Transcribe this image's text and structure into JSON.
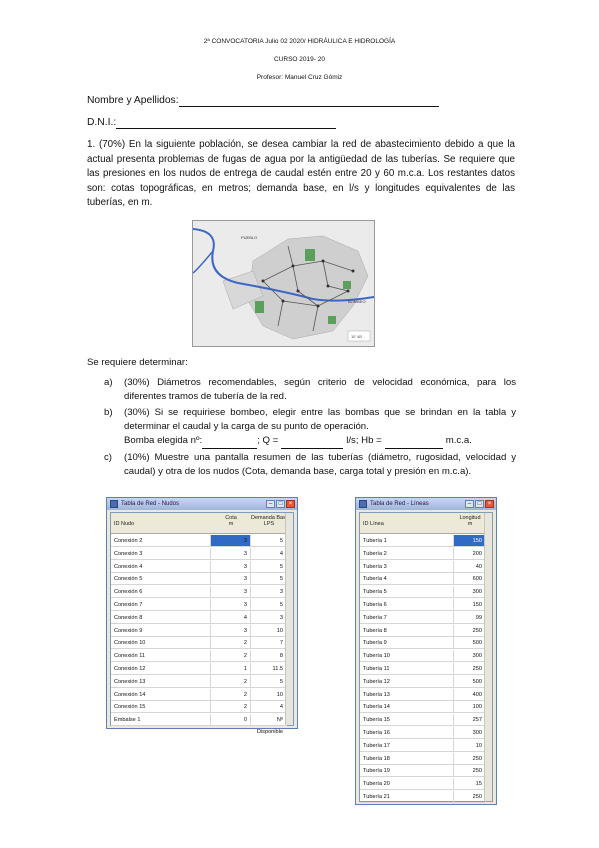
{
  "header": {
    "convocatoria": "2ª CONVOCATORIA Julio 02 2020/ HIDRÁULICA E HIDROLOGÍA",
    "curso": "CURSO 2019- 20",
    "profesor": "Profesor: Manuel Cruz Gómiz"
  },
  "form": {
    "nombre_label": "Nombre y Apellidos:",
    "dni_label": "D.N.I.:"
  },
  "question": {
    "text_l1": "1. (70%) En la siguiente población, se desea cambiar la red de abastecimiento debido a que la",
    "text_l2": "actual presenta problemas de fugas de agua por la antigüedad de las tuberías. Se requiere que",
    "text_l3": "las presiones en los nudos de entrega de caudal estén entre 20 y 60 m.c.a. Los restantes datos",
    "text_l4": "son: cotas topográficas, en metros; demanda base, en l/s y longitudes equivalentes de las",
    "text_l5": "tuberías, en m."
  },
  "map": {
    "label_top": "PUEBLO",
    "label_right": "BOMBEO",
    "scale": "1E 4B"
  },
  "requirements": {
    "intro": "Se requiere determinar:",
    "a_label": "a)",
    "a_l1": "(30%) Diámetros recomendables, según criterio de velocidad económica, para los",
    "a_l2": "diferentes tramos de tubería de la red.",
    "b_label": "b)",
    "b_l1": "(30%) Si se requiriese bombeo, elegir entre las bombas que se brindan en la tabla y",
    "b_l2": "determinar el caudal y la carga de su punto de operación.",
    "b_l3_a": "Bomba elegida nº:",
    "b_l3_b": "; Q =",
    "b_l3_c": "l/s; Hb =",
    "b_l3_d": "m.c.a.",
    "c_label": "c)",
    "c_l1": "(10%) Muestre una pantalla resumen de las tuberías (diámetro, rugosidad, velocidad y",
    "c_l2": "caudal) y otra de los nudos (Cota, demanda base, carga total y presión en m.c.a)."
  },
  "nodes_window": {
    "title": "Tabla de Red - Nudos",
    "col_id": "ID Nudo",
    "col_cota": "Cota\nm",
    "col_demanda": "Demanda Base\nLPS",
    "rows": [
      {
        "id": "Conexión 2",
        "cota": "3",
        "demanda": "5",
        "selected": true
      },
      {
        "id": "Conexión 3",
        "cota": "3",
        "demanda": "4"
      },
      {
        "id": "Conexión 4",
        "cota": "3",
        "demanda": "5"
      },
      {
        "id": "Conexión 5",
        "cota": "3",
        "demanda": "5"
      },
      {
        "id": "Conexión 6",
        "cota": "3",
        "demanda": "3"
      },
      {
        "id": "Conexión 7",
        "cota": "3",
        "demanda": "5"
      },
      {
        "id": "Conexión 8",
        "cota": "4",
        "demanda": "3"
      },
      {
        "id": "Conexión 9",
        "cota": "3",
        "demanda": "10"
      },
      {
        "id": "Conexión 10",
        "cota": "2",
        "demanda": "7"
      },
      {
        "id": "Conexión 11",
        "cota": "2",
        "demanda": "8"
      },
      {
        "id": "Conexión 12",
        "cota": "1",
        "demanda": "11.5"
      },
      {
        "id": "Conexión 13",
        "cota": "2",
        "demanda": "5"
      },
      {
        "id": "Conexión 14",
        "cota": "2",
        "demanda": "10"
      },
      {
        "id": "Conexión 15",
        "cota": "2",
        "demanda": "4"
      },
      {
        "id": "Embalse 1",
        "cota": "0",
        "demanda": "Nº Disponible"
      }
    ]
  },
  "pipes_window": {
    "title": "Tabla de Red - Líneas",
    "col_id": "ID Línea",
    "col_len": "Longitud\nm",
    "rows": [
      {
        "id": "Tubería 1",
        "len": "150",
        "selected": true
      },
      {
        "id": "Tubería 2",
        "len": "200"
      },
      {
        "id": "Tubería 3",
        "len": "40"
      },
      {
        "id": "Tubería 4",
        "len": "600"
      },
      {
        "id": "Tubería 5",
        "len": "300"
      },
      {
        "id": "Tubería 6",
        "len": "150"
      },
      {
        "id": "Tubería 7",
        "len": "99"
      },
      {
        "id": "Tubería 8",
        "len": "250"
      },
      {
        "id": "Tubería 9",
        "len": "500"
      },
      {
        "id": "Tubería 10",
        "len": "300"
      },
      {
        "id": "Tubería 11",
        "len": "250"
      },
      {
        "id": "Tubería 12",
        "len": "500"
      },
      {
        "id": "Tubería 13",
        "len": "400"
      },
      {
        "id": "Tubería 14",
        "len": "100"
      },
      {
        "id": "Tubería 15",
        "len": "257"
      },
      {
        "id": "Tubería 16",
        "len": "300"
      },
      {
        "id": "Tubería 17",
        "len": "10"
      },
      {
        "id": "Tubería 18",
        "len": "250"
      },
      {
        "id": "Tubería 19",
        "len": "250"
      },
      {
        "id": "Tubería 20",
        "len": "15"
      },
      {
        "id": "Tubería 21",
        "len": "250"
      }
    ]
  }
}
